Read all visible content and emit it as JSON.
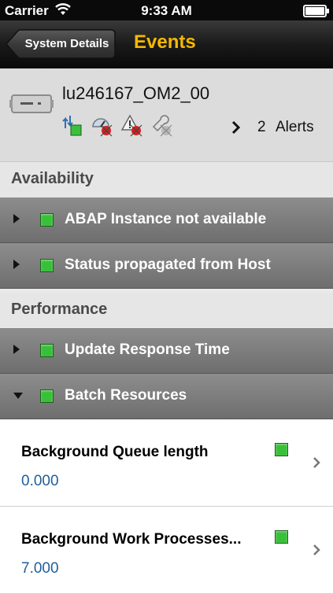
{
  "status_bar": {
    "carrier": "Carrier",
    "time": "9:33 AM"
  },
  "nav": {
    "back_label": "System Details",
    "title": "Events"
  },
  "system": {
    "name": "lu246167_OM2_00",
    "alert_count": "2",
    "alert_label": "Alerts",
    "status_icons": [
      "system-status-green-icon",
      "performance-red-icon",
      "exception-red-icon",
      "configuration-grey-icon"
    ]
  },
  "sections": [
    {
      "title": "Availability",
      "rows": [
        {
          "label": "ABAP Instance not available",
          "status": "green",
          "expanded": false
        },
        {
          "label": "Status propagated from Host",
          "status": "green",
          "expanded": false
        }
      ]
    },
    {
      "title": "Performance",
      "rows": [
        {
          "label": "Update Response Time",
          "status": "green",
          "expanded": false
        },
        {
          "label": "Batch Resources",
          "status": "green",
          "expanded": true
        }
      ]
    }
  ],
  "details": [
    {
      "title": "Background Queue length",
      "value": "0.000",
      "status": "green"
    },
    {
      "title": "Background Work Processes...",
      "value": "7.000",
      "status": "green"
    }
  ],
  "colors": {
    "accent_title": "#f5b800",
    "status_green": "#39c03a",
    "value_blue": "#1f5e9c",
    "alarm_red": "#d42020"
  }
}
